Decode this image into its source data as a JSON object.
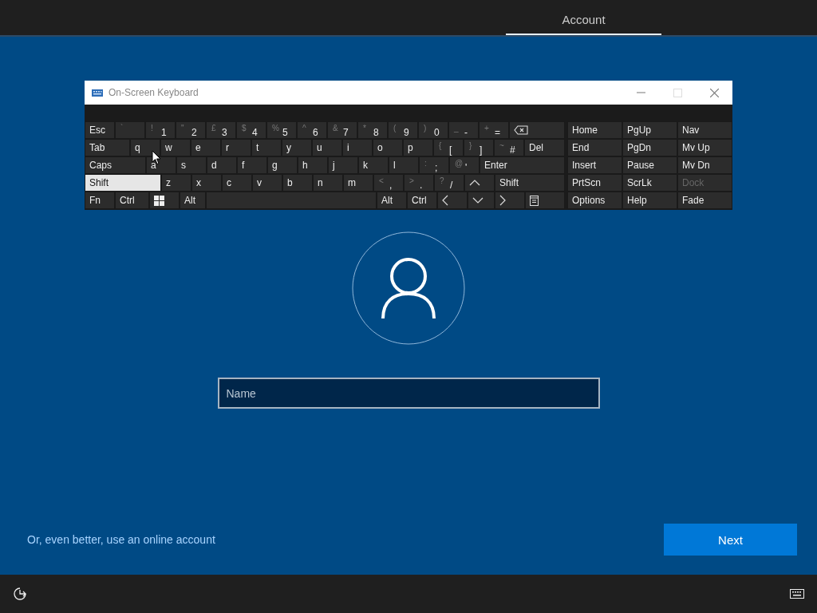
{
  "top_bar": {
    "tabs": [
      {
        "label": "Account",
        "selected": true
      }
    ]
  },
  "osk": {
    "title": "On-Screen Keyboard",
    "rows": [
      [
        {
          "kind": "label",
          "label": "Esc",
          "pressed": false
        },
        {
          "kind": "dual",
          "shift": "`",
          "pressed": false
        },
        {
          "kind": "dual",
          "shift": "!",
          "main": "1",
          "pressed": false
        },
        {
          "kind": "dual",
          "shift": "\"",
          "main": "2",
          "pressed": false
        },
        {
          "kind": "dual",
          "shift": "£",
          "main": "3",
          "pressed": false
        },
        {
          "kind": "dual",
          "shift": "$",
          "main": "4",
          "pressed": false
        },
        {
          "kind": "dual",
          "shift": "%",
          "main": "5",
          "pressed": false
        },
        {
          "kind": "dual",
          "shift": "^",
          "main": "6",
          "pressed": false
        },
        {
          "kind": "dual",
          "shift": "&",
          "main": "7",
          "pressed": false
        },
        {
          "kind": "dual",
          "shift": "*",
          "main": "8",
          "pressed": false
        },
        {
          "kind": "dual",
          "shift": "(",
          "main": "9",
          "pressed": false
        },
        {
          "kind": "dual",
          "shift": ")",
          "main": "0",
          "pressed": false
        },
        {
          "kind": "dual",
          "shift": "_",
          "main": "-",
          "pressed": false
        },
        {
          "kind": "dual",
          "shift": "+",
          "main": "=",
          "pressed": false
        },
        {
          "kind": "backspace",
          "pressed": false
        }
      ],
      [
        {
          "kind": "label",
          "label": "Tab",
          "pressed": false
        },
        {
          "kind": "letter",
          "label": "q",
          "pressed": false
        },
        {
          "kind": "letter",
          "label": "w",
          "pressed": false
        },
        {
          "kind": "letter",
          "label": "e",
          "pressed": false
        },
        {
          "kind": "letter",
          "label": "r",
          "pressed": false
        },
        {
          "kind": "letter",
          "label": "t",
          "pressed": false
        },
        {
          "kind": "letter",
          "label": "y",
          "pressed": false
        },
        {
          "kind": "letter",
          "label": "u",
          "pressed": false
        },
        {
          "kind": "letter",
          "label": "i",
          "pressed": false
        },
        {
          "kind": "letter",
          "label": "o",
          "pressed": false
        },
        {
          "kind": "letter",
          "label": "p",
          "pressed": false
        },
        {
          "kind": "dual",
          "shift": "{",
          "main": "[",
          "pressed": false
        },
        {
          "kind": "dual",
          "shift": "}",
          "main": "]",
          "pressed": false
        },
        {
          "kind": "dual",
          "shift": "~",
          "main": "#",
          "pressed": false
        },
        {
          "kind": "label",
          "label": "Del",
          "pressed": false
        }
      ],
      [
        {
          "kind": "label",
          "label": "Caps",
          "pressed": false
        },
        {
          "kind": "letter",
          "label": "a",
          "pressed": false
        },
        {
          "kind": "letter",
          "label": "s",
          "pressed": false
        },
        {
          "kind": "letter",
          "label": "d",
          "pressed": false
        },
        {
          "kind": "letter",
          "label": "f",
          "pressed": false
        },
        {
          "kind": "letter",
          "label": "g",
          "pressed": false
        },
        {
          "kind": "letter",
          "label": "h",
          "pressed": false
        },
        {
          "kind": "letter",
          "label": "j",
          "pressed": false
        },
        {
          "kind": "letter",
          "label": "k",
          "pressed": false
        },
        {
          "kind": "letter",
          "label": "l",
          "pressed": false
        },
        {
          "kind": "dual",
          "shift": ":",
          "main": ";",
          "pressed": false
        },
        {
          "kind": "dual",
          "shift": "@",
          "main": "'",
          "pressed": false
        },
        {
          "kind": "label",
          "label": "Enter",
          "pressed": false
        }
      ],
      [
        {
          "kind": "label",
          "label": "Shift",
          "pressed": true
        },
        {
          "kind": "letter",
          "label": "z",
          "pressed": false
        },
        {
          "kind": "letter",
          "label": "x",
          "pressed": false
        },
        {
          "kind": "letter",
          "label": "c",
          "pressed": false
        },
        {
          "kind": "letter",
          "label": "v",
          "pressed": false
        },
        {
          "kind": "letter",
          "label": "b",
          "pressed": false
        },
        {
          "kind": "letter",
          "label": "n",
          "pressed": false
        },
        {
          "kind": "letter",
          "label": "m",
          "pressed": false
        },
        {
          "kind": "dual",
          "shift": "<",
          "main": ",",
          "pressed": false
        },
        {
          "kind": "dual",
          "shift": ">",
          "main": ".",
          "pressed": false
        },
        {
          "kind": "dual",
          "shift": "?",
          "main": "/",
          "pressed": false
        },
        {
          "kind": "up",
          "pressed": false
        },
        {
          "kind": "label",
          "label": "Shift",
          "pressed": false
        }
      ],
      [
        {
          "kind": "label",
          "label": "Fn",
          "pressed": false
        },
        {
          "kind": "label",
          "label": "Ctrl",
          "pressed": false
        },
        {
          "kind": "windows",
          "pressed": false
        },
        {
          "kind": "label",
          "label": "Alt",
          "pressed": false
        },
        {
          "kind": "space",
          "pressed": false
        },
        {
          "kind": "label",
          "label": "Alt",
          "pressed": false
        },
        {
          "kind": "label",
          "label": "Ctrl",
          "pressed": false
        },
        {
          "kind": "left",
          "pressed": false
        },
        {
          "kind": "down",
          "pressed": false
        },
        {
          "kind": "right",
          "pressed": false
        },
        {
          "kind": "menu",
          "pressed": false
        }
      ]
    ],
    "side_keys": [
      {
        "label": "Home",
        "disabled": false
      },
      {
        "label": "PgUp",
        "disabled": false
      },
      {
        "label": "Nav",
        "disabled": false
      },
      {
        "label": "End",
        "disabled": false
      },
      {
        "label": "PgDn",
        "disabled": false
      },
      {
        "label": "Mv Up",
        "disabled": false
      },
      {
        "label": "Insert",
        "disabled": false
      },
      {
        "label": "Pause",
        "disabled": false
      },
      {
        "label": "Mv Dn",
        "disabled": false
      },
      {
        "label": "PrtScn",
        "disabled": false
      },
      {
        "label": "ScrLk",
        "disabled": false
      },
      {
        "label": "Dock",
        "disabled": true
      },
      {
        "label": "Options",
        "disabled": false
      },
      {
        "label": "Help",
        "disabled": false
      },
      {
        "label": "Fade",
        "disabled": false
      }
    ]
  },
  "name_field": {
    "placeholder": "Name"
  },
  "online_account_link": "Or, even better, use an online account",
  "next_button": "Next"
}
